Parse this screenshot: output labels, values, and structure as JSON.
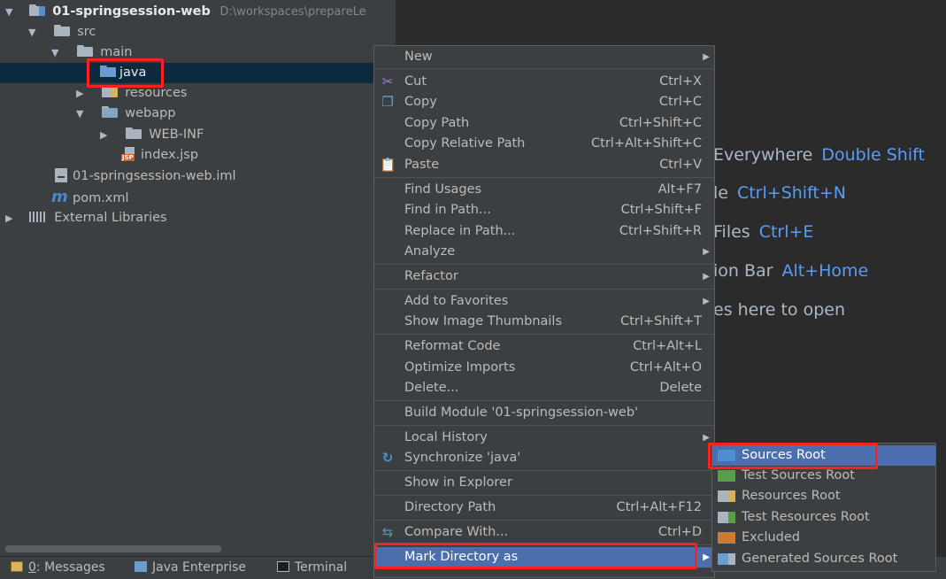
{
  "project_tree": {
    "root": {
      "name": "01-springsession-web",
      "path": "D:\\workspaces\\prepareLe"
    },
    "items": [
      {
        "label": "src"
      },
      {
        "label": "main"
      },
      {
        "label": "java"
      },
      {
        "label": "resources"
      },
      {
        "label": "webapp"
      },
      {
        "label": "WEB-INF"
      },
      {
        "label": "index.jsp",
        "badge": "JSP"
      },
      {
        "label": "01-springsession-web.iml"
      },
      {
        "label": "pom.xml",
        "icon_glyph": "m"
      },
      {
        "label": "External Libraries"
      }
    ],
    "expand_glyph": "▼",
    "collapse_glyph": "▶"
  },
  "editor_hints": [
    {
      "text": "Everywhere",
      "key": "Double Shift"
    },
    {
      "text": "le",
      "key": "Ctrl+Shift+N"
    },
    {
      "text": "Files",
      "key": "Ctrl+E"
    },
    {
      "text": "ion Bar",
      "key": "Alt+Home"
    },
    {
      "text": "es here to open",
      "key": ""
    }
  ],
  "context_menu": {
    "items": [
      {
        "label": "New",
        "shortcut": "",
        "submenu": "▶"
      },
      {
        "label": "Cut",
        "shortcut": "Ctrl+X",
        "icon": "✂"
      },
      {
        "label": "Copy",
        "shortcut": "Ctrl+C",
        "icon": "❐"
      },
      {
        "label": "Copy Path",
        "shortcut": "Ctrl+Shift+C"
      },
      {
        "label": "Copy Relative Path",
        "shortcut": "Ctrl+Alt+Shift+C"
      },
      {
        "label": "Paste",
        "shortcut": "Ctrl+V",
        "icon": "📋"
      },
      {
        "label": "Find Usages",
        "shortcut": "Alt+F7"
      },
      {
        "label": "Find in Path...",
        "shortcut": "Ctrl+Shift+F"
      },
      {
        "label": "Replace in Path...",
        "shortcut": "Ctrl+Shift+R"
      },
      {
        "label": "Analyze",
        "shortcut": "",
        "submenu": "▶"
      },
      {
        "label": "Refactor",
        "shortcut": "",
        "submenu": "▶"
      },
      {
        "label": "Add to Favorites",
        "shortcut": "",
        "submenu": "▶"
      },
      {
        "label": "Show Image Thumbnails",
        "shortcut": "Ctrl+Shift+T"
      },
      {
        "label": "Reformat Code",
        "shortcut": "Ctrl+Alt+L"
      },
      {
        "label": "Optimize Imports",
        "shortcut": "Ctrl+Alt+O"
      },
      {
        "label": "Delete...",
        "shortcut": "Delete"
      },
      {
        "label": "Build Module '01-springsession-web'",
        "shortcut": ""
      },
      {
        "label": "Local History",
        "shortcut": "",
        "submenu": "▶"
      },
      {
        "label": "Synchronize 'java'",
        "shortcut": "",
        "icon": "↻"
      },
      {
        "label": "Show in Explorer",
        "shortcut": ""
      },
      {
        "label": "Directory Path",
        "shortcut": "Ctrl+Alt+F12"
      },
      {
        "label": "Compare With...",
        "shortcut": "Ctrl+D",
        "icon": "⇆"
      },
      {
        "label": "Mark Directory as",
        "shortcut": "",
        "submenu": "▶"
      }
    ]
  },
  "mark_directory_submenu": {
    "items": [
      {
        "label": "Sources Root",
        "color": "#4f8fd1"
      },
      {
        "label": "Test Sources Root",
        "color": "#5c9e47"
      },
      {
        "label": "Resources Root",
        "color": "#aab4bf"
      },
      {
        "label": "Test Resources Root",
        "color": "#aab4bf"
      },
      {
        "label": "Excluded",
        "color": "#cf7b2f"
      },
      {
        "label": "Generated Sources Root",
        "color": "#6c9ccf"
      }
    ]
  },
  "tool_windows": {
    "messages_num": "0",
    "messages_label": ": Messages",
    "java_enterprise": "Java Enterprise",
    "terminal": "Terminal"
  },
  "colors": {
    "selection": "#4b6eaf",
    "highlight_box": "#ff2020",
    "link": "#589df6"
  }
}
